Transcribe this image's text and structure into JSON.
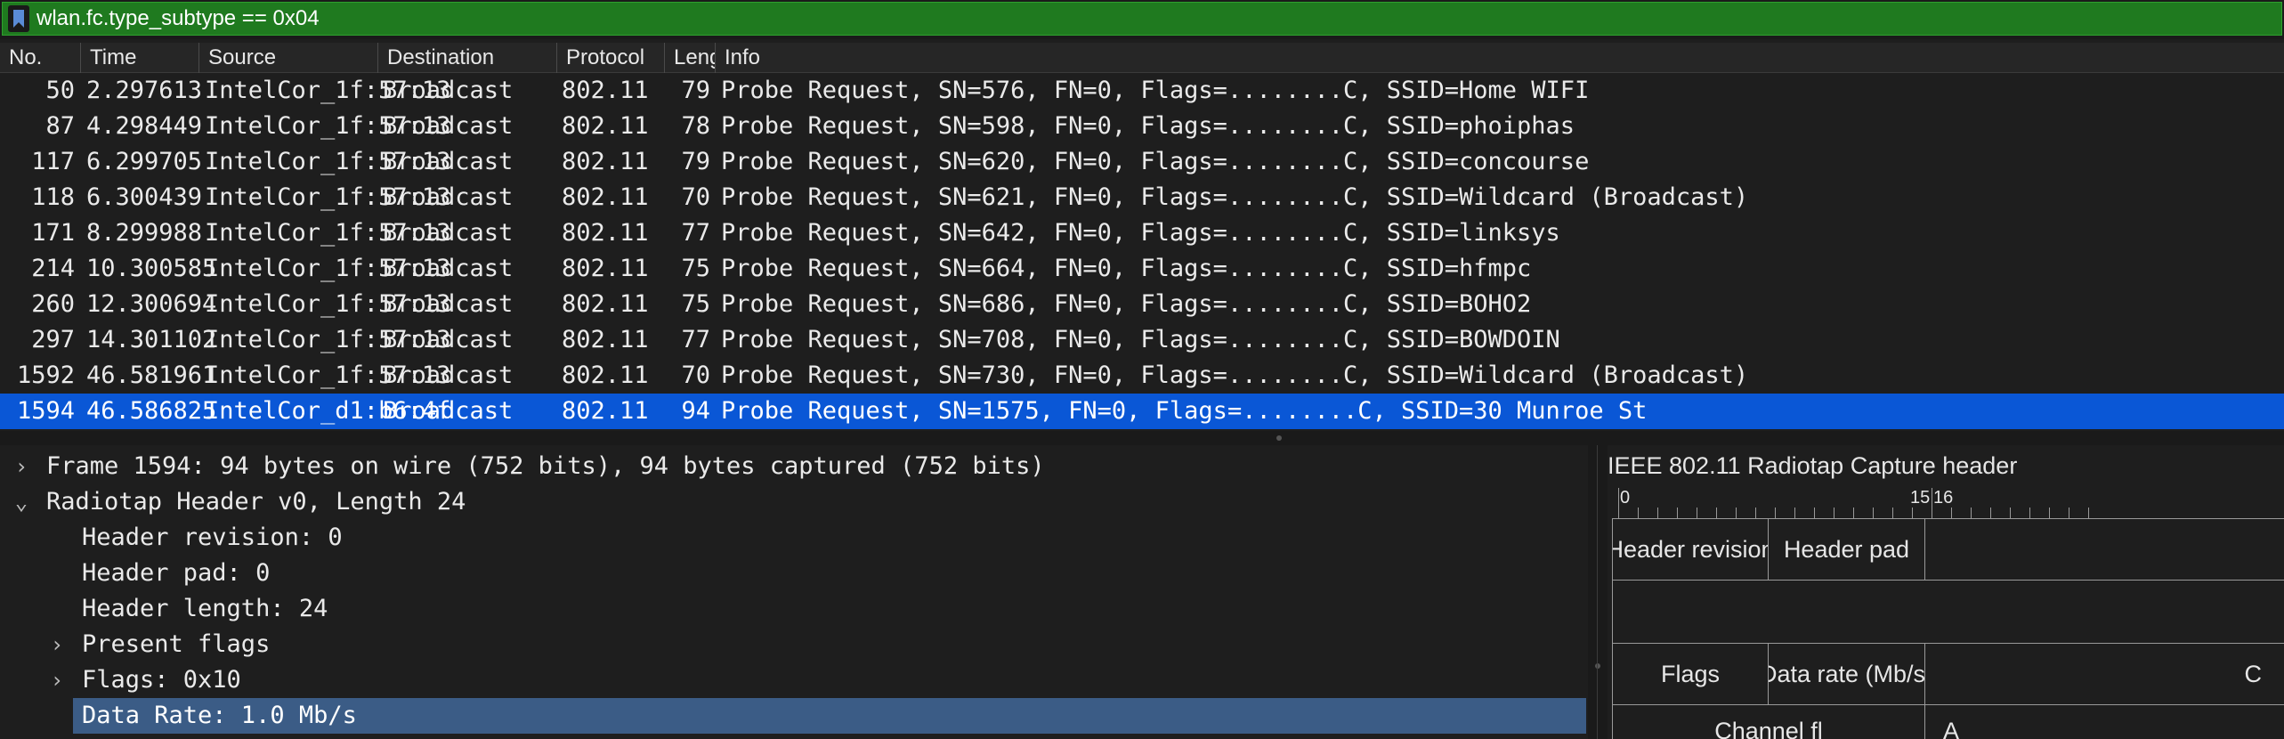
{
  "filter": {
    "value": "wlan.fc.type_subtype == 0x04"
  },
  "columns": [
    "No.",
    "Time",
    "Source",
    "Destination",
    "Protocol",
    "Length",
    "Info"
  ],
  "packets": [
    {
      "no": "50",
      "time": "2.297613",
      "source": "IntelCor_1f:57:13",
      "destination": "Broadcast",
      "protocol": "802.11",
      "length": "79",
      "info": "Probe Request, SN=576, FN=0, Flags=........C, SSID=Home WIFI"
    },
    {
      "no": "87",
      "time": "4.298449",
      "source": "IntelCor_1f:57:13",
      "destination": "Broadcast",
      "protocol": "802.11",
      "length": "78",
      "info": "Probe Request, SN=598, FN=0, Flags=........C, SSID=phoiphas"
    },
    {
      "no": "117",
      "time": "6.299705",
      "source": "IntelCor_1f:57:13",
      "destination": "Broadcast",
      "protocol": "802.11",
      "length": "79",
      "info": "Probe Request, SN=620, FN=0, Flags=........C, SSID=concourse"
    },
    {
      "no": "118",
      "time": "6.300439",
      "source": "IntelCor_1f:57:13",
      "destination": "Broadcast",
      "protocol": "802.11",
      "length": "70",
      "info": "Probe Request, SN=621, FN=0, Flags=........C, SSID=Wildcard (Broadcast)"
    },
    {
      "no": "171",
      "time": "8.299988",
      "source": "IntelCor_1f:57:13",
      "destination": "Broadcast",
      "protocol": "802.11",
      "length": "77",
      "info": "Probe Request, SN=642, FN=0, Flags=........C, SSID=linksys"
    },
    {
      "no": "214",
      "time": "10.300585",
      "source": "IntelCor_1f:57:13",
      "destination": "Broadcast",
      "protocol": "802.11",
      "length": "75",
      "info": "Probe Request, SN=664, FN=0, Flags=........C, SSID=hfmpc"
    },
    {
      "no": "260",
      "time": "12.300694",
      "source": "IntelCor_1f:57:13",
      "destination": "Broadcast",
      "protocol": "802.11",
      "length": "75",
      "info": "Probe Request, SN=686, FN=0, Flags=........C, SSID=BOHO2"
    },
    {
      "no": "297",
      "time": "14.301102",
      "source": "IntelCor_1f:57:13",
      "destination": "Broadcast",
      "protocol": "802.11",
      "length": "77",
      "info": "Probe Request, SN=708, FN=0, Flags=........C, SSID=BOWDOIN"
    },
    {
      "no": "1592",
      "time": "46.581961",
      "source": "IntelCor_1f:57:13",
      "destination": "Broadcast",
      "protocol": "802.11",
      "length": "70",
      "info": "Probe Request, SN=730, FN=0, Flags=........C, SSID=Wildcard (Broadcast)"
    },
    {
      "no": "1594",
      "time": "46.586825",
      "source": "IntelCor_d1:b6:4f",
      "destination": "Broadcast",
      "protocol": "802.11",
      "length": "94",
      "info": "Probe Request, SN=1575, FN=0, Flags=........C, SSID=30 Munroe St",
      "selected": true
    }
  ],
  "details": [
    {
      "arrow": "›",
      "text": "Frame 1594: 94 bytes on wire (752 bits), 94 bytes captured (752 bits)"
    },
    {
      "arrow": "⌄",
      "text": "Radiotap Header v0, Length 24"
    },
    {
      "arrow": "",
      "text": "Header revision: 0"
    },
    {
      "arrow": "",
      "text": "Header pad: 0"
    },
    {
      "arrow": "",
      "text": "Header length: 24"
    },
    {
      "arrow": "›",
      "text": "Present flags"
    },
    {
      "arrow": "›",
      "text": "Flags: 0x10"
    },
    {
      "arrow": "",
      "text": "Data Rate: 1.0 Mb/s",
      "selected": true
    }
  ],
  "bytes_pane": {
    "title": "IEEE 802.11 Radiotap Capture header",
    "ruler_labels": [
      "0",
      "15",
      "16"
    ],
    "fields": [
      "Header revision",
      "Header pad",
      "Flags",
      "Data rate (Mb/s)",
      "C",
      "Channel fl",
      "A"
    ]
  },
  "colors": {
    "filter_bg": "#1f7a1f",
    "selected_row": "#0a57d6",
    "selected_detail": "#3b5c86"
  }
}
